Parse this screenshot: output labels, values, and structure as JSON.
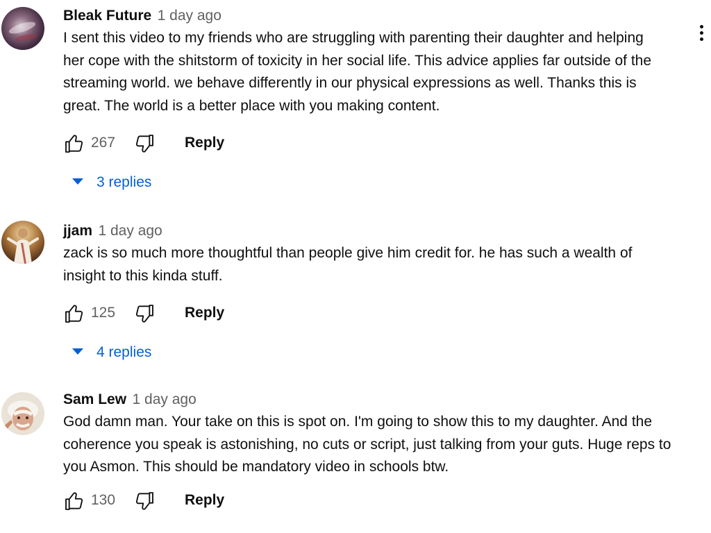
{
  "comments": [
    {
      "author": "Bleak Future",
      "time": "1 day ago",
      "text": "I sent this video to my friends who are struggling with parenting their daughter and helping her cope with the shitstorm of toxicity in her social life. This advice applies far outside of the streaming world. we behave differently in our physical expressions as well. Thanks this is great. The world is a better place with you making content.",
      "likes": "267",
      "reply_label": "Reply",
      "replies_label": "3 replies",
      "avatar_icon": "galaxy-avatar"
    },
    {
      "author": "jjam",
      "time": "1 day ago",
      "text": "zack is so much more thoughtful than people give him credit for. he has such a wealth of insight to this kinda stuff.",
      "likes": "125",
      "reply_label": "Reply",
      "replies_label": "4 replies",
      "avatar_icon": "robed-figure-avatar"
    },
    {
      "author": "Sam Lew",
      "time": "1 day ago",
      "text": "God damn man. Your take on this is spot on. I'm going to show this to my daughter. And the coherence you speak is astonishing, no cuts or script, just talking from your guts. Huge reps to you Asmon. This should be mandatory video in schools btw.",
      "likes": "130",
      "reply_label": "Reply",
      "avatar_icon": "elderly-man-avatar"
    }
  ],
  "colors": {
    "text": "#0f0f0f",
    "secondary": "#606060",
    "link_blue": "#065fd4"
  },
  "icons": {
    "like": "thumb-up-icon",
    "dislike": "thumb-down-icon",
    "menu": "more-vert-icon",
    "expand": "caret-down-icon"
  }
}
